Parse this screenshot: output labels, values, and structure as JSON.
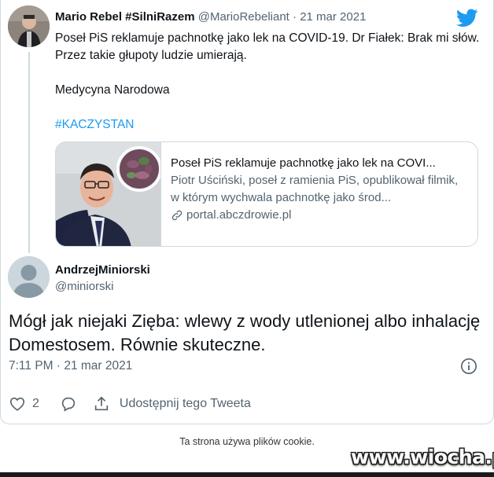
{
  "tweet": {
    "author_name": "Mario Rebel #SilniRazem",
    "author_handle": "@MarioRebeliant",
    "separator": "·",
    "date": "21 mar 2021",
    "text_line1": "Poseł PiS reklamuje pachnotkę jako lek na COVID-19. Dr Fiałek: Brak mi słów. Przez takie głupoty ludzie umierają.",
    "text_line2": "Medycyna Narodowa",
    "hashtag": "#KACZYSTAN",
    "icon_logo": "twitter-bird-icon"
  },
  "card": {
    "title": "Poseł PiS reklamuje pachnotkę jako lek na COVI...",
    "description": "Piotr Uściński, poseł z ramienia PiS, opublikował filmik, w którym wychwala pachnotkę jako środ...",
    "link": "portal.abczdrowie.pl",
    "icon_link": "link-icon"
  },
  "reply": {
    "author_name": "AndrzejMiniorski",
    "author_handle": "@miniorski",
    "text": "Mógł jak niejaki Zięba: wlewy z wody utlenionej albo inhalację Domestosem. Równie skuteczne.",
    "time": "7:11 PM · 21 mar 2021",
    "icon_info": "info-icon"
  },
  "actions": {
    "like_count": "2",
    "share_label": "Udostępnij tego Tweeta",
    "icon_like": "heart-icon",
    "icon_reply": "reply-bubble-icon",
    "icon_share": "share-upload-icon"
  },
  "footer": {
    "cookie_notice": "Ta strona używa plików cookie.",
    "watermark": "www.wiocha.pl"
  },
  "colors": {
    "accent": "#1d9bf0",
    "text_primary": "#0f1419",
    "text_secondary": "#536471",
    "border": "#cfd9de"
  }
}
